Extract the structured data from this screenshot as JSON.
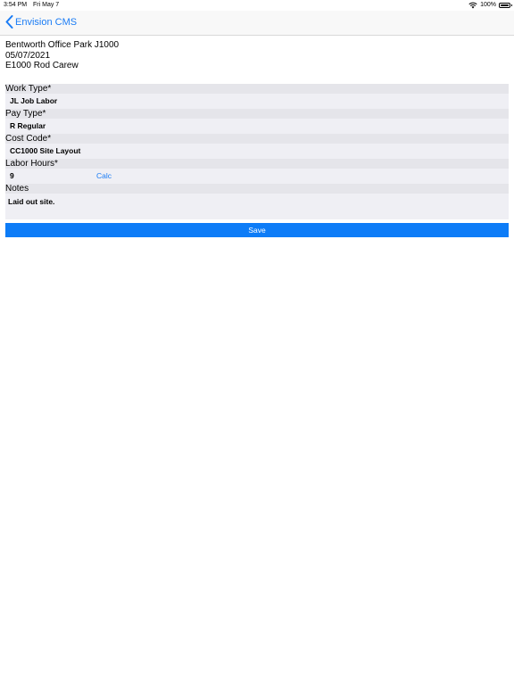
{
  "status": {
    "time": "3:54 PM",
    "date": "Fri May 7",
    "battery": "100%"
  },
  "nav": {
    "back_label": "Envision CMS"
  },
  "info": {
    "project": "Bentworth Office Park J1000",
    "date": "05/07/2021",
    "employee": "E1000 Rod Carew"
  },
  "form": {
    "work_type_label": "Work Type*",
    "work_type_value": "JL Job Labor",
    "pay_type_label": "Pay Type*",
    "pay_type_value": "R Regular",
    "cost_code_label": "Cost Code*",
    "cost_code_value": "CC1000 Site Layout",
    "labor_hours_label": "Labor Hours*",
    "labor_hours_value": "9",
    "calc_label": "Calc",
    "notes_label": "Notes",
    "notes_value": "Laid out site.",
    "save_label": "Save"
  },
  "colors": {
    "accent": "#1a7cf5",
    "save_button": "#0d7cf7",
    "label_bg": "#e5e5ea",
    "value_bg": "#efeff4"
  }
}
